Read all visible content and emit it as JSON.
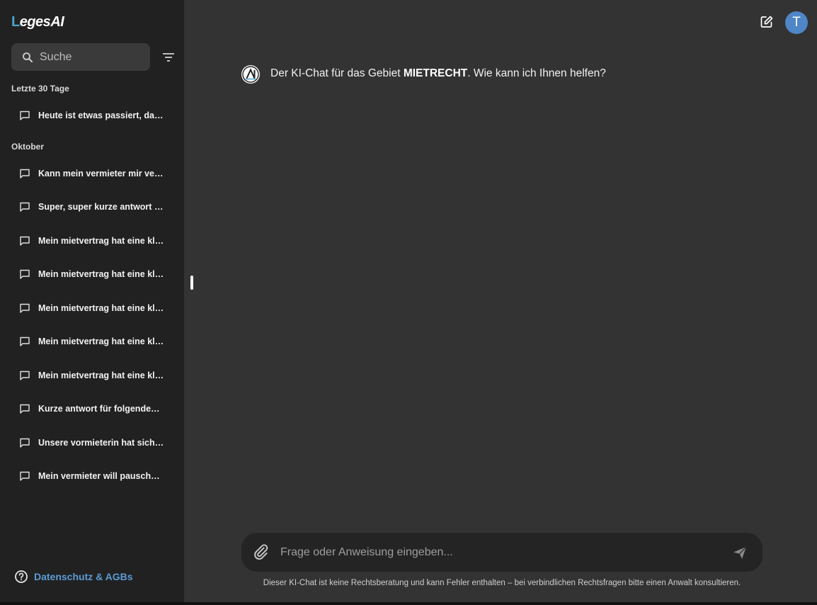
{
  "app": {
    "logo_prefix": "L",
    "logo_text": "eges",
    "logo_suffix": "AI"
  },
  "sidebar": {
    "search_placeholder": "Suche",
    "sections": [
      {
        "title": "Letzte 30 Tage",
        "items": [
          "Heute ist etwas passiert, das…"
        ]
      },
      {
        "title": "Oktober",
        "items": [
          "Kann mein vermieter mir ver…",
          "Super, super kurze antwort h…",
          "Mein mietvertrag hat eine kl…",
          "Mein mietvertrag hat eine kl…",
          "Mein mietvertrag hat eine kl…",
          "Mein mietvertrag hat eine kl…",
          "Mein mietvertrag hat eine kl…",
          "Kurze antwort für folgendes …",
          "Unsere vormieterin hat sich l…",
          "Mein vermieter will pauschal…"
        ]
      }
    ],
    "footer_link": "Datenschutz & AGBs"
  },
  "header": {
    "avatar_initial": "T"
  },
  "chat": {
    "greeting_before": "Der KI-Chat für das Gebiet ",
    "greeting_topic": "MIETRECHT",
    "greeting_after": ". Wie kann ich Ihnen helfen?"
  },
  "composer": {
    "placeholder": "Frage oder Anweisung eingeben...",
    "disclaimer": "Dieser KI-Chat ist keine Rechtsberatung und kann Fehler enthalten – bei verbindlichen Rechtsfragen bitte einen Anwalt konsultieren."
  },
  "colors": {
    "sidebar_bg": "#212121",
    "main_bg": "#333333",
    "accent_link": "#5b9bd5",
    "avatar_bg": "#4f86c6"
  }
}
